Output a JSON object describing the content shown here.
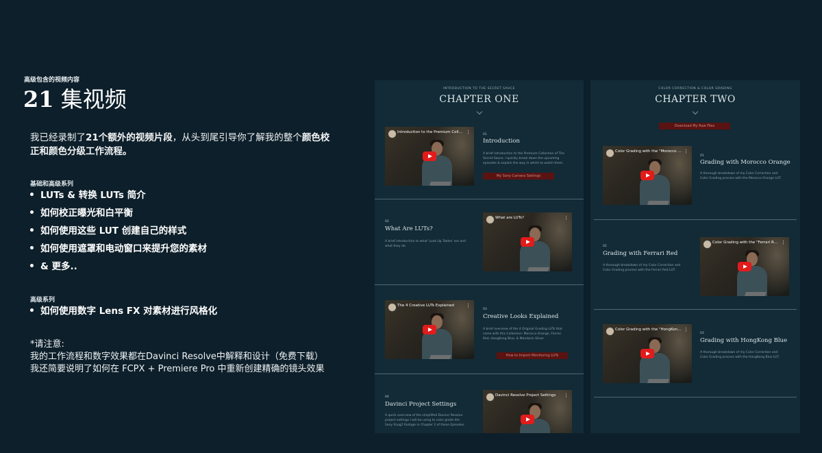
{
  "left": {
    "eyebrow": "高级包含的视频内容",
    "title_num": "21",
    "title_text": " 集视频",
    "intro_a": "我已经录制了",
    "intro_b": "21个额外的视频片段",
    "intro_c": "，从头到尾引导你了解我的整个",
    "intro_d": "颜色校正和颜色分级工作流程。",
    "section1_label": "基础和高级系列",
    "section1_items": [
      "LUTs & 转换 LUTs 简介",
      "如何校正曝光和白平衡",
      "如何使用这些 LUT 创建自己的样式",
      "如何使用遮罩和电动窗口来提升您的素材",
      "& 更多.."
    ],
    "section2_label": "高级系列",
    "section2_items": [
      "如何使用数字 Lens FX 对素材进行风格化"
    ],
    "note_lines": [
      "*请注意:",
      "我的工作流程和数字效果都在Davinci Resolve中解释和设计（免费下载）",
      "我还简要说明了如何在 FCPX + Premiere Pro 中重新创建精确的镜头效果"
    ]
  },
  "chapter_one": {
    "eyebrow": "INTRODUCTION TO THE SECRET SAUCE",
    "title": "CHAPTER ONE",
    "items": [
      {
        "num": "01",
        "title": "Introduction",
        "desc": "A brief introduction to the Premium Collection of The Secret Sauce. I quickly break down the upcoming episodes & explain the way in which to watch them.",
        "video_title": "Introduction to the Premium Collecti...",
        "button": "My Sony Camera Settings"
      },
      {
        "num": "02",
        "title": "What Are LUTs?",
        "desc": "A brief introduction to what 'Look Up Tables' are and what they do.",
        "video_title": "What are LUTs?"
      },
      {
        "num": "03",
        "title": "Creative Looks Explained",
        "desc": "A brief overview of the 4 Original Grading LUTs that come with this Collection: Morocco Orange, Ferrari Red, HongKong Blue, & Mandarin Silver.",
        "video_title": "The 4 Creative LUTs Explained",
        "button": "How to Import Monitoring LUTs"
      },
      {
        "num": "04",
        "title": "Davinci Project Settings",
        "desc": "A quick overview of the simplified Davinci Resolve project settings I will be using to color grade the Sony SLog2 footage in Chapter 2 of these Episodes.",
        "video_title": "Davinci Resolve Project Settings"
      }
    ]
  },
  "chapter_two": {
    "eyebrow": "COLOR CORRECTION & COLOR GRADING",
    "title": "CHAPTER TWO",
    "button": "Download My Raw Files",
    "items": [
      {
        "num": "01",
        "title": "Grading with Morocco Orange",
        "desc": "A thorough breakdown of my Color Correction and Color Grading process with the Morocco Orange LUT.",
        "video_title": "Color Grading with the \"Morocco Ora..."
      },
      {
        "num": "02",
        "title": "Grading with Ferrari Red",
        "desc": "A thorough breakdown of my Color Correction and Color Grading process with the Ferrari Red LUT.",
        "video_title": "Color Grading with the \"Ferrari Red\" ..."
      },
      {
        "num": "03",
        "title": "Grading with HongKong Blue",
        "desc": "A thorough breakdown of my Color Correction and Color Grading process with the HongKong Blue LUT.",
        "video_title": "Color Grading with the \"HongKong Bl..."
      }
    ]
  },
  "colors": {
    "background": "#0d1f2a",
    "panel": "#122b36",
    "accent_red": "#5a1312",
    "youtube_red": "#e21b1b"
  }
}
